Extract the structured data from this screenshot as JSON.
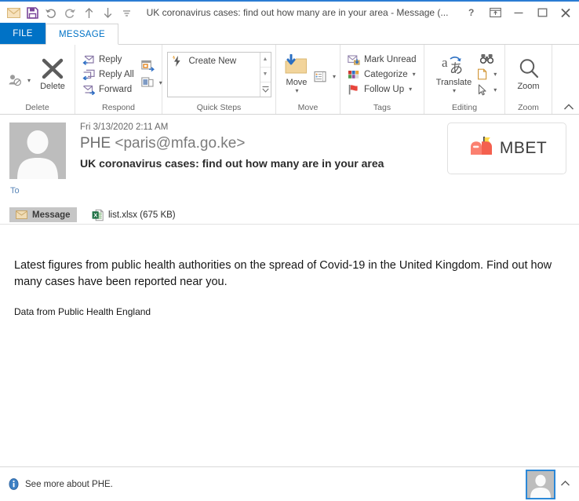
{
  "window": {
    "title": "UK coronavirus cases: find out how many are in your area - Message (...",
    "quick_access": [
      {
        "name": "envelope-icon",
        "label": "Message"
      },
      {
        "name": "save-icon",
        "label": "Save"
      },
      {
        "name": "undo-icon",
        "label": "Undo"
      },
      {
        "name": "redo-icon",
        "label": "Redo"
      },
      {
        "name": "previous-item-icon",
        "label": "Previous Item"
      },
      {
        "name": "next-item-icon",
        "label": "Next Item"
      },
      {
        "name": "customize-qat-icon",
        "label": "Customize Quick Access Toolbar"
      }
    ],
    "controls": [
      {
        "name": "help-button",
        "glyph": "?"
      },
      {
        "name": "ribbon-display-options-button",
        "glyph": "ribbon"
      },
      {
        "name": "minimize-button",
        "glyph": "minimize"
      },
      {
        "name": "maximize-button",
        "glyph": "maximize"
      },
      {
        "name": "close-button",
        "glyph": "close"
      }
    ]
  },
  "tabs": {
    "file": "FILE",
    "message": "MESSAGE"
  },
  "ribbon": {
    "collapse_label": "Collapse the Ribbon",
    "groups": [
      {
        "name": "delete",
        "label": "Delete",
        "items": [
          {
            "name": "ignore-button",
            "label": ""
          },
          {
            "name": "delete-button",
            "label": "Delete"
          }
        ]
      },
      {
        "name": "respond",
        "label": "Respond",
        "items": [
          {
            "name": "reply-button",
            "label": "Reply"
          },
          {
            "name": "reply-all-button",
            "label": "Reply All"
          },
          {
            "name": "forward-button",
            "label": "Forward"
          },
          {
            "name": "meeting-button",
            "label": ""
          },
          {
            "name": "more-respond-button",
            "label": ""
          }
        ]
      },
      {
        "name": "quick-steps",
        "label": "Quick Steps",
        "items": [
          {
            "name": "create-new-quick-step",
            "label": "Create New"
          }
        ]
      },
      {
        "name": "move",
        "label": "Move",
        "items": [
          {
            "name": "move-button",
            "label": "Move"
          },
          {
            "name": "rules-button",
            "label": ""
          }
        ]
      },
      {
        "name": "tags",
        "label": "Tags",
        "items": [
          {
            "name": "mark-unread-button",
            "label": "Mark Unread"
          },
          {
            "name": "categorize-button",
            "label": "Categorize"
          },
          {
            "name": "follow-up-button",
            "label": "Follow Up"
          }
        ]
      },
      {
        "name": "editing",
        "label": "Editing",
        "items": [
          {
            "name": "translate-button",
            "label": "Translate"
          },
          {
            "name": "find-button",
            "label": ""
          },
          {
            "name": "related-button",
            "label": ""
          },
          {
            "name": "select-button",
            "label": ""
          }
        ]
      },
      {
        "name": "zoom",
        "label": "Zoom",
        "items": [
          {
            "name": "zoom-button",
            "label": "Zoom"
          }
        ]
      }
    ]
  },
  "message": {
    "sent": "Fri 3/13/2020 2:11 AM",
    "sender_name": "PHE",
    "sender_address": "<paris@mfa.go.ke>",
    "subject": "UK coronavirus cases: find out how many are in your area",
    "to_label": "To",
    "to_value": "",
    "brand": {
      "icon": "mailbox-icon",
      "text": "MBET",
      "mailbox_color": "#f4604e",
      "mailbox_color_light": "#fb8070",
      "flag_color": "#ffd94a"
    },
    "message_tab": "Message",
    "attachment": {
      "icon": "excel-file-icon",
      "label": "list.xlsx (675 KB)",
      "name": "list.xlsx",
      "size": "675 KB"
    },
    "body_paragraph_1": "Latest figures from public health authorities on the spread of Covid-19 in the United Kingdom. Find out how many cases have been reported near you.",
    "body_paragraph_2": "Data from Public Health England"
  },
  "status": {
    "see_more": "See more about PHE.",
    "info_icon": "info-icon",
    "contact_photo": "contact-photo",
    "expand_icon": "chevron-up-icon"
  },
  "colors": {
    "accent_blue": "#0072c6",
    "titlebar_border": "#2b7cd3",
    "brand_red": "#f4604e",
    "excel_green": "#1d7044"
  }
}
